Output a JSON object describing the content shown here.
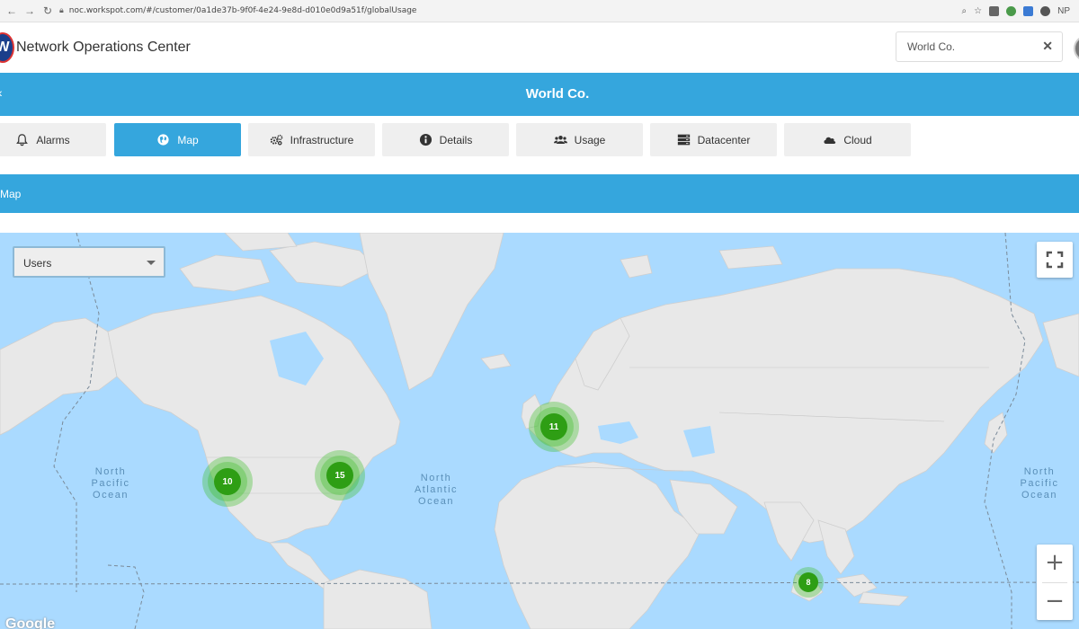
{
  "browser": {
    "url": "noc.workspot.com/#/customer/0a1de37b-9f0f-4e24-9e8d-d010e0d9a51f/globalUsage",
    "profile_initials": "NP"
  },
  "header": {
    "app_title": "Network Operations Center",
    "logo_letter": "W",
    "search": {
      "value": "World Co."
    }
  },
  "customer_bar": {
    "name": "World Co."
  },
  "tabs": [
    {
      "label": "Alarms",
      "icon": "bell-icon",
      "active": false
    },
    {
      "label": "Map",
      "icon": "globe-icon",
      "active": true
    },
    {
      "label": "Infrastructure",
      "icon": "gears-icon",
      "active": false
    },
    {
      "label": "Details",
      "icon": "info-icon",
      "active": false
    },
    {
      "label": "Usage",
      "icon": "users-icon",
      "active": false
    },
    {
      "label": "Datacenter",
      "icon": "server-icon",
      "active": false
    },
    {
      "label": "Cloud",
      "icon": "cloud-icon",
      "active": false
    }
  ],
  "section": {
    "title": "Map"
  },
  "map": {
    "layer_select": {
      "value": "Users"
    },
    "ocean_labels": [
      "North\nPacific\nOcean",
      "North\nAtlantic\nOcean",
      "North\nPacific\nOcean"
    ],
    "clusters": [
      {
        "count": "10",
        "region": "US West"
      },
      {
        "count": "15",
        "region": "US East"
      },
      {
        "count": "11",
        "region": "Europe"
      },
      {
        "count": "8",
        "region": "Southeast Asia"
      }
    ],
    "zoom_in_label": "+",
    "zoom_out_label": "−",
    "attribution": "Google",
    "colors": {
      "ocean": "#aadaff",
      "land": "#e8e8e8",
      "cluster": "#2e9e14",
      "accent": "#35a6dd"
    }
  }
}
